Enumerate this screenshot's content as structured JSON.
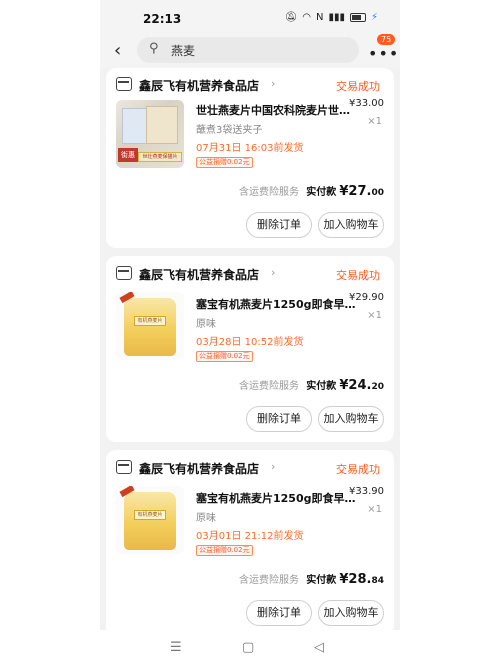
{
  "status_bar": {
    "time": "22:13",
    "icons": [
      "mute-icon",
      "wifi-icon",
      "nfc-icon",
      "signal-icon",
      "battery-icon",
      "charging-icon"
    ],
    "battery": "4"
  },
  "search": {
    "query": "燕麦",
    "cart_badge": "75"
  },
  "orders": [
    {
      "shop": "鑫辰飞有机营养食品店",
      "status": "交易成功",
      "title": "世壮燕麦片中国农科院麦片世…",
      "spec": "蘸煮3袋送夹子",
      "ship_time": "07月31日 16:03前发货",
      "charity": "公益捐赠0.02元",
      "price": "¥33.00",
      "qty": "×1",
      "insurance": "含运费险服务",
      "paid_label": "实付款",
      "paid_int": "¥27.",
      "paid_dec": "00",
      "thumb_tag": "街惠",
      "thumb_strip": "世壮燕麦保猫片",
      "delete_label": "删除订单",
      "cart_label": "加入购物车"
    },
    {
      "shop": "鑫辰飞有机营养食品店",
      "status": "交易成功",
      "title": "塞宝有机燕麦片1250g即食早…",
      "spec": "原味",
      "ship_time": "03月28日 10:52前发货",
      "charity": "公益捐赠0.02元",
      "price": "¥29.90",
      "qty": "×1",
      "insurance": "含运费险服务",
      "paid_label": "实付款",
      "paid_int": "¥24.",
      "paid_dec": "20",
      "thumb_label": "有机燕麦片",
      "delete_label": "删除订单",
      "cart_label": "加入购物车"
    },
    {
      "shop": "鑫辰飞有机营养食品店",
      "status": "交易成功",
      "title": "塞宝有机燕麦片1250g即食早…",
      "spec": "原味",
      "ship_time": "03月01日 21:12前发货",
      "charity": "公益捐赠0.02元",
      "price": "¥33.90",
      "qty": "×1",
      "insurance": "含运费险服务",
      "paid_label": "实付款",
      "paid_int": "¥28.",
      "paid_dec": "84",
      "thumb_label": "有机燕麦片",
      "delete_label": "删除订单",
      "cart_label": "加入购物车"
    }
  ],
  "nav": {
    "menu": "☰",
    "home": "▢",
    "back": "◁"
  }
}
